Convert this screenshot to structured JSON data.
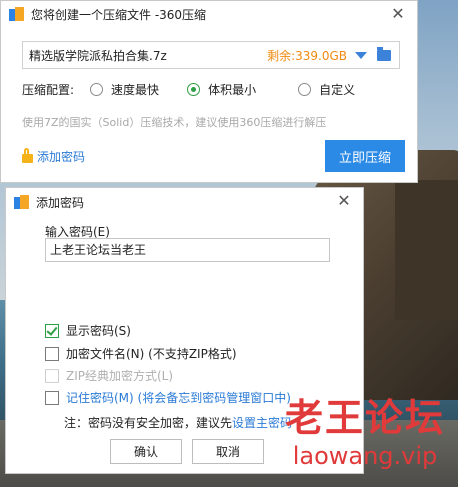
{
  "main_window": {
    "title": "您将创建一个压缩文件 -360压缩",
    "file_name": "精选版学院派私拍合集.7z",
    "free_space": "剩余:339.0GB",
    "config_label": "压缩配置:",
    "options": [
      "速度最快",
      "体积最小",
      "自定义"
    ],
    "selected_option": "体积最小",
    "note": "使用7Z的国实（Solid）压缩技术，建议使用360压缩进行解压",
    "add_password_link": "添加密码",
    "compress_button": "立即压缩"
  },
  "password_dialog": {
    "title": "添加密码",
    "input_label": "输入密码(E)",
    "input_value": "上老王论坛当老王",
    "show_password": {
      "label": "显示密码(S)",
      "checked": true
    },
    "encrypt_filename": {
      "label": "加密文件名(N) (不支持ZIP格式)",
      "checked": false
    },
    "zip_classic": {
      "label": "ZIP经典加密方式(L)",
      "checked": false,
      "disabled": true
    },
    "remember_password": {
      "label": "记住密码(M) (将会备忘到密码管理窗口中)",
      "checked": false
    },
    "hint_prefix": "注：密码没有安全加密，建议先",
    "hint_link": "设置主密码",
    "confirm_button": "确认",
    "cancel_button": "取消"
  },
  "watermark": {
    "title": "老王论坛",
    "url": "laowang.vip"
  },
  "colors": {
    "accent": "#2b8ae6",
    "free_space": "#f08a10",
    "check": "#2f9e44",
    "watermark": "#e03a3a"
  }
}
